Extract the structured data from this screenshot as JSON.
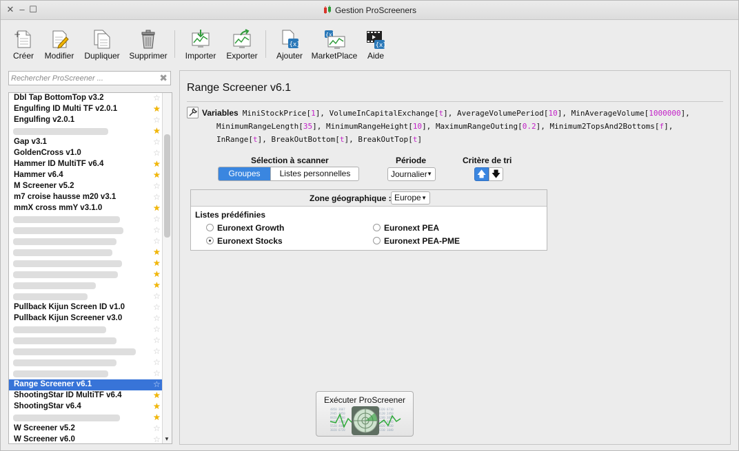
{
  "window": {
    "title": "Gestion ProScreeners"
  },
  "toolbar": {
    "create": "Créer",
    "modify": "Modifier",
    "duplicate": "Dupliquer",
    "delete": "Supprimer",
    "import": "Importer",
    "export": "Exporter",
    "add": "Ajouter",
    "marketplace": "MarketPlace",
    "help": "Aide"
  },
  "search": {
    "placeholder": "Rechercher ProScreener ..."
  },
  "list": {
    "items": [
      {
        "label": "Dbl Tap BottomTop v3.2",
        "star": "empty"
      },
      {
        "label": "Engulfing ID Multi TF v2.0.1",
        "star": "filled"
      },
      {
        "label": "Engulfing v2.0.1",
        "star": "empty"
      },
      {
        "label": "",
        "star": "filled"
      },
      {
        "label": "Gap v3.1",
        "star": "empty"
      },
      {
        "label": "GoldenCross v1.0",
        "star": "empty"
      },
      {
        "label": "Hammer ID MultiTF v6.4",
        "star": "filled"
      },
      {
        "label": "Hammer v6.4",
        "star": "filled"
      },
      {
        "label": "M Screener v5.2",
        "star": "empty"
      },
      {
        "label": "m7 croise hausse m20 v3.1",
        "star": "empty"
      },
      {
        "label": "mmX cross mmY v3.1.0",
        "star": "filled"
      },
      {
        "label": "",
        "star": "empty"
      },
      {
        "label": "",
        "star": "empty"
      },
      {
        "label": "",
        "star": "empty"
      },
      {
        "label": "",
        "star": "filled"
      },
      {
        "label": "",
        "star": "filled"
      },
      {
        "label": "",
        "star": "filled"
      },
      {
        "label": "",
        "star": "filled"
      },
      {
        "label": "",
        "star": "empty"
      },
      {
        "label": "Pullback Kijun Screen ID v1.0",
        "star": "empty"
      },
      {
        "label": "Pullback Kijun Screener v3.0",
        "star": "empty"
      },
      {
        "label": "",
        "star": "empty"
      },
      {
        "label": "",
        "star": "empty"
      },
      {
        "label": "",
        "star": "empty"
      },
      {
        "label": "",
        "star": "empty"
      },
      {
        "label": "",
        "star": "empty"
      },
      {
        "label": "Range Screener v6.1",
        "star": "empty",
        "selected": true
      },
      {
        "label": "ShootingStar ID MultiTF v6.4",
        "star": "filled"
      },
      {
        "label": "ShootingStar v6.4",
        "star": "filled"
      },
      {
        "label": "",
        "star": "filled"
      },
      {
        "label": "W Screener v5.2",
        "star": "empty"
      },
      {
        "label": "W Screener v6.0",
        "star": "empty"
      }
    ]
  },
  "main": {
    "title": "Range Screener v6.1",
    "variables_label": "Variables",
    "variables": [
      {
        "name": "MiniStockPrice",
        "value": "1"
      },
      {
        "name": "VolumeInCapitalExchange",
        "value": "t"
      },
      {
        "name": "AverageVolumePeriod",
        "value": "10"
      },
      {
        "name": "MinAverageVolume",
        "value": "1000000"
      },
      {
        "name": "MinimumRangeLength",
        "value": "35"
      },
      {
        "name": "MinimumRangeHeight",
        "value": "10"
      },
      {
        "name": "MaximumRangeOuting",
        "value": "0.2"
      },
      {
        "name": "Minimum2TopsAnd2Bottoms",
        "value": "f"
      },
      {
        "name": "InRange",
        "value": "t"
      },
      {
        "name": "BreakOutBottom",
        "value": "t"
      },
      {
        "name": "BreakOutTop",
        "value": "t"
      }
    ],
    "selection_label": "Sélection à scanner",
    "selection_tabs": [
      "Groupes",
      "Listes personnelles"
    ],
    "period_label": "Période",
    "period_value": "Journalier",
    "sort_label": "Critère de tri",
    "zone_label": "Zone géographique :",
    "zone_value": "Europe",
    "predefined_label": "Listes prédéfinies",
    "lists": [
      {
        "label": "Euronext Growth",
        "checked": false
      },
      {
        "label": "Euronext PEA",
        "checked": false
      },
      {
        "label": "Euronext Stocks",
        "checked": true
      },
      {
        "label": "Euronext PEA-PME",
        "checked": false
      }
    ],
    "execute_label": "Exécuter ProScreener"
  },
  "colors": {
    "accent": "#3a86e0",
    "selected_row": "#3874d8",
    "value": "#c21fc7",
    "star": "#f2b705"
  }
}
